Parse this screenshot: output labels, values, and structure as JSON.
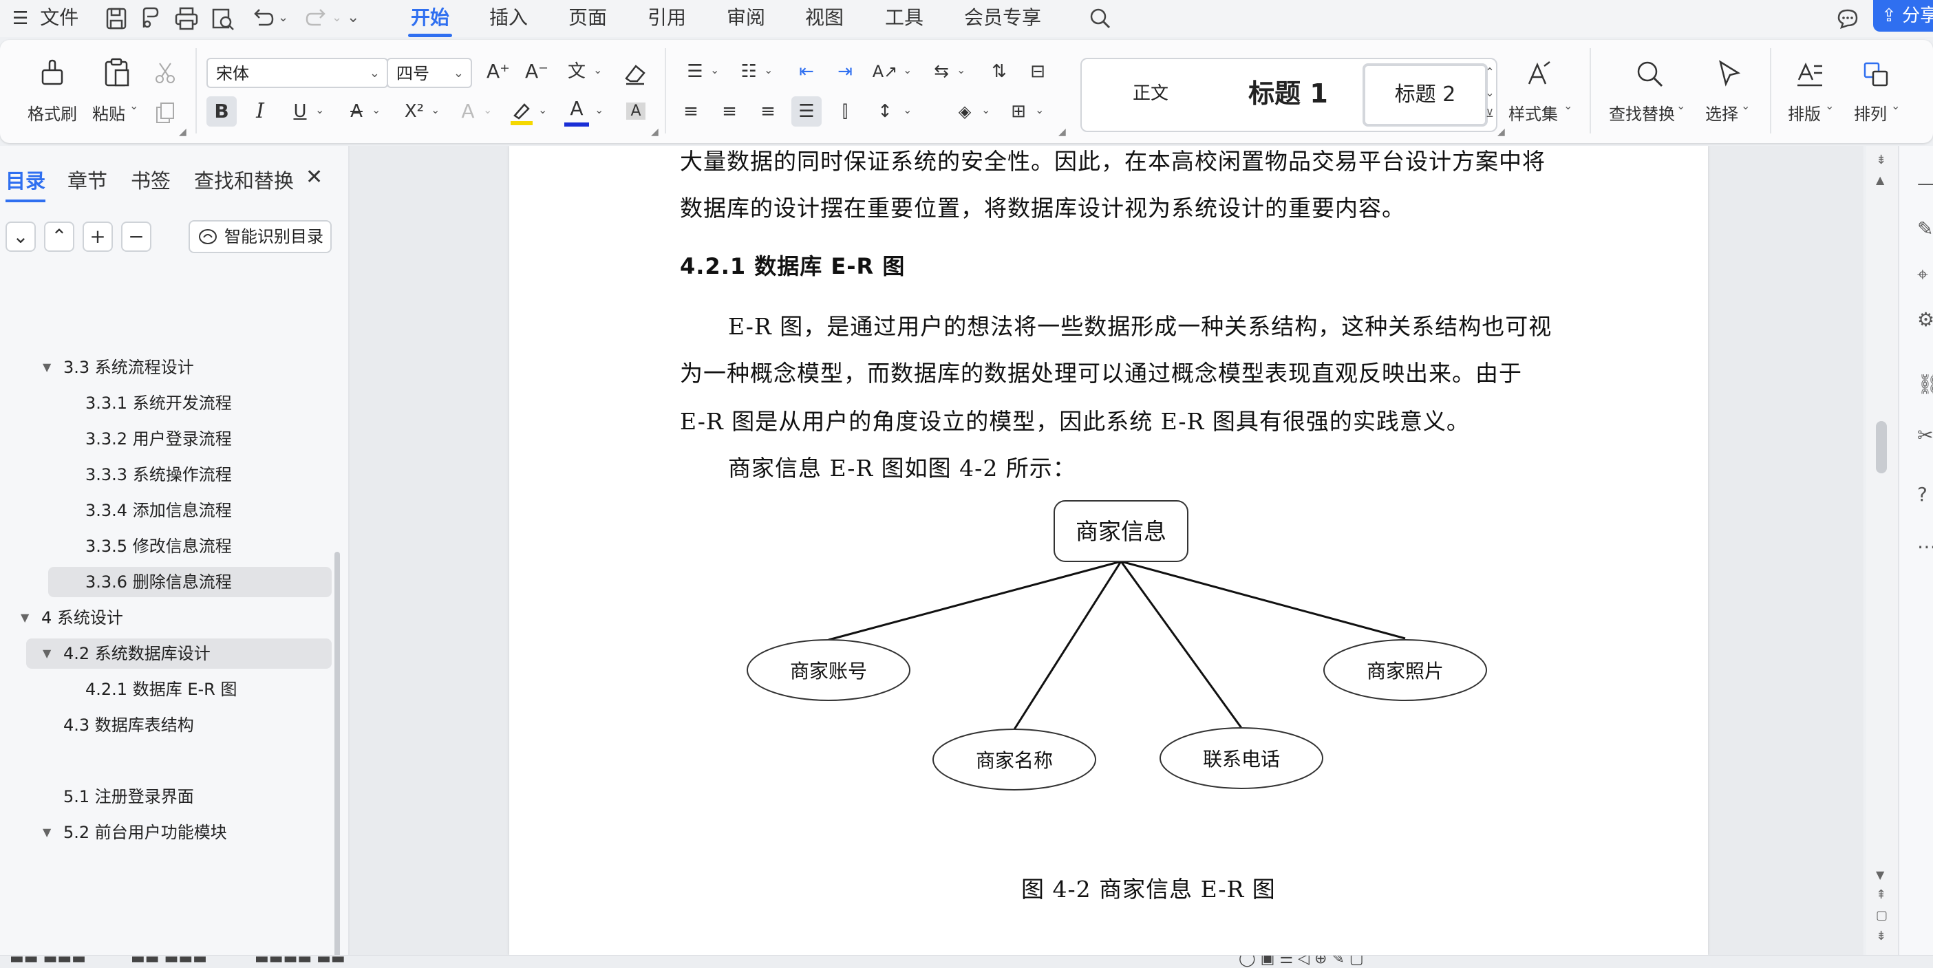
{
  "menubar": {
    "file_label": "文件",
    "tabs": [
      "开始",
      "插入",
      "页面",
      "引用",
      "审阅",
      "视图",
      "工具",
      "会员专享"
    ],
    "share_label": "分享"
  },
  "ribbon": {
    "format_painter": "格式刷",
    "paste": "粘贴",
    "font_name": "宋体",
    "font_size": "四号",
    "styles": {
      "normal": "正文",
      "heading1": "标题 1",
      "heading2": "标题 2"
    },
    "style_set": "样式集",
    "find_replace": "查找替换",
    "select": "选择",
    "layout": "排版",
    "arrange": "排列",
    "font_color_hex": "#1a2fd6",
    "highlight_color_hex": "#f5d800"
  },
  "leftpanel": {
    "tabs": [
      "目录",
      "章节",
      "书签",
      "查找和替换"
    ],
    "smart_toc_label": "智能识别目录",
    "toc": [
      {
        "text": "3.3 系统流程设计"
      },
      {
        "text": "3.3.1  系统开发流程"
      },
      {
        "text": "3.3.2  用户登录流程"
      },
      {
        "text": "3.3.3  系统操作流程"
      },
      {
        "text": "3.3.4  添加信息流程"
      },
      {
        "text": "3.3.5  修改信息流程"
      },
      {
        "text": "3.3.6  删除信息流程"
      },
      {
        "text": "4 系统设计"
      },
      {
        "text": "4.2 系统数据库设计"
      },
      {
        "text": "4.2.1 数据库 E-R 图"
      },
      {
        "text": "4.3 数据库表结构"
      },
      {
        "text": "5.1 注册登录界面"
      },
      {
        "text": "5.2 前台用户功能模块"
      }
    ]
  },
  "document": {
    "para1_line1": "大量数据的同时保证系统的安全性。因此，在本高校闲置物品交易平台设计方案中将",
    "para1_line2": "数据库的设计摆在重要位置，将数据库设计视为系统设计的重要内容。",
    "heading": "4.2.1 数据库 E-R 图",
    "para2_line1": "E-R 图，是通过用户的想法将一些数据形成一种关系结构，这种关系结构也可视",
    "para2_line2": "为一种概念模型，而数据库的数据处理可以通过概念模型表现直观反映出来。由于",
    "para2_line3": "E-R 图是从用户的角度设立的模型，因此系统 E-R 图具有很强的实践意义。",
    "para3": "商家信息 E-R 图如图 4-2 所示：",
    "figure": {
      "entity": "商家信息",
      "attributes": [
        "商家账号",
        "商家名称",
        "联系电话",
        "商家照片"
      ],
      "caption": "图 4-2 商家信息 E-R 图"
    }
  }
}
